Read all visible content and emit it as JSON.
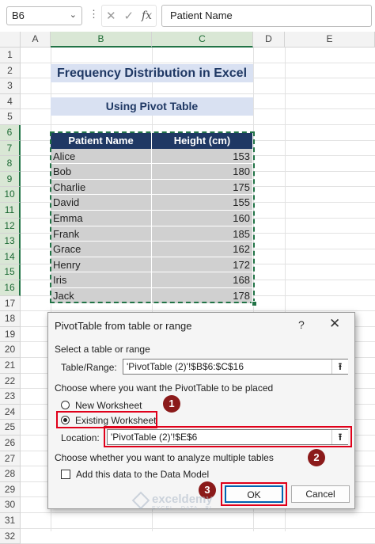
{
  "formula_bar": {
    "name_box": "B6",
    "formula": "Patient Name"
  },
  "columns": [
    "A",
    "B",
    "C",
    "D",
    "E"
  ],
  "rows": [
    "1",
    "2",
    "3",
    "4",
    "5",
    "6",
    "7",
    "8",
    "9",
    "10",
    "11",
    "12",
    "13",
    "14",
    "15",
    "16",
    "17",
    "18",
    "19",
    "20",
    "21",
    "22",
    "23",
    "24",
    "25",
    "26",
    "27",
    "28",
    "29",
    "30",
    "31",
    "32"
  ],
  "sheet": {
    "title": "Frequency Distribution in Excel",
    "subtitle": "Using Pivot Table",
    "table_headers": [
      "Patient Name",
      "Height (cm)"
    ],
    "table_rows": [
      {
        "name": "Alice",
        "height": "153"
      },
      {
        "name": "Bob",
        "height": "180"
      },
      {
        "name": "Charlie",
        "height": "175"
      },
      {
        "name": "David",
        "height": "155"
      },
      {
        "name": "Emma",
        "height": "160"
      },
      {
        "name": "Frank",
        "height": "185"
      },
      {
        "name": "Grace",
        "height": "162"
      },
      {
        "name": "Henry",
        "height": "172"
      },
      {
        "name": "Iris",
        "height": "168"
      },
      {
        "name": "Jack",
        "height": "178"
      }
    ]
  },
  "dialog": {
    "title": "PivotTable from table or range",
    "help": "?",
    "close": "✕",
    "section_select": "Select a table or range",
    "table_range_label": "Table/Range:",
    "table_range_value": "'PivotTable (2)'!$B$6:$C$16",
    "section_place": "Choose where you want the PivotTable to be placed",
    "option_new": "New Worksheet",
    "option_existing": "Existing Worksheet",
    "location_label": "Location:",
    "location_value": "'PivotTable (2)'!$E$6",
    "section_multiple": "Choose whether you want to analyze multiple tables",
    "add_data_model": "Add this data to the Data Model",
    "ok_label": "OK",
    "cancel_label": "Cancel"
  },
  "annotations": {
    "step1": "1",
    "step2": "2",
    "step3": "3",
    "color": "#8b1a1a",
    "highlight_color": "#e0001a"
  },
  "watermark": {
    "name": "exceldemy",
    "tagline": "EXCEL · DATA · BI"
  }
}
